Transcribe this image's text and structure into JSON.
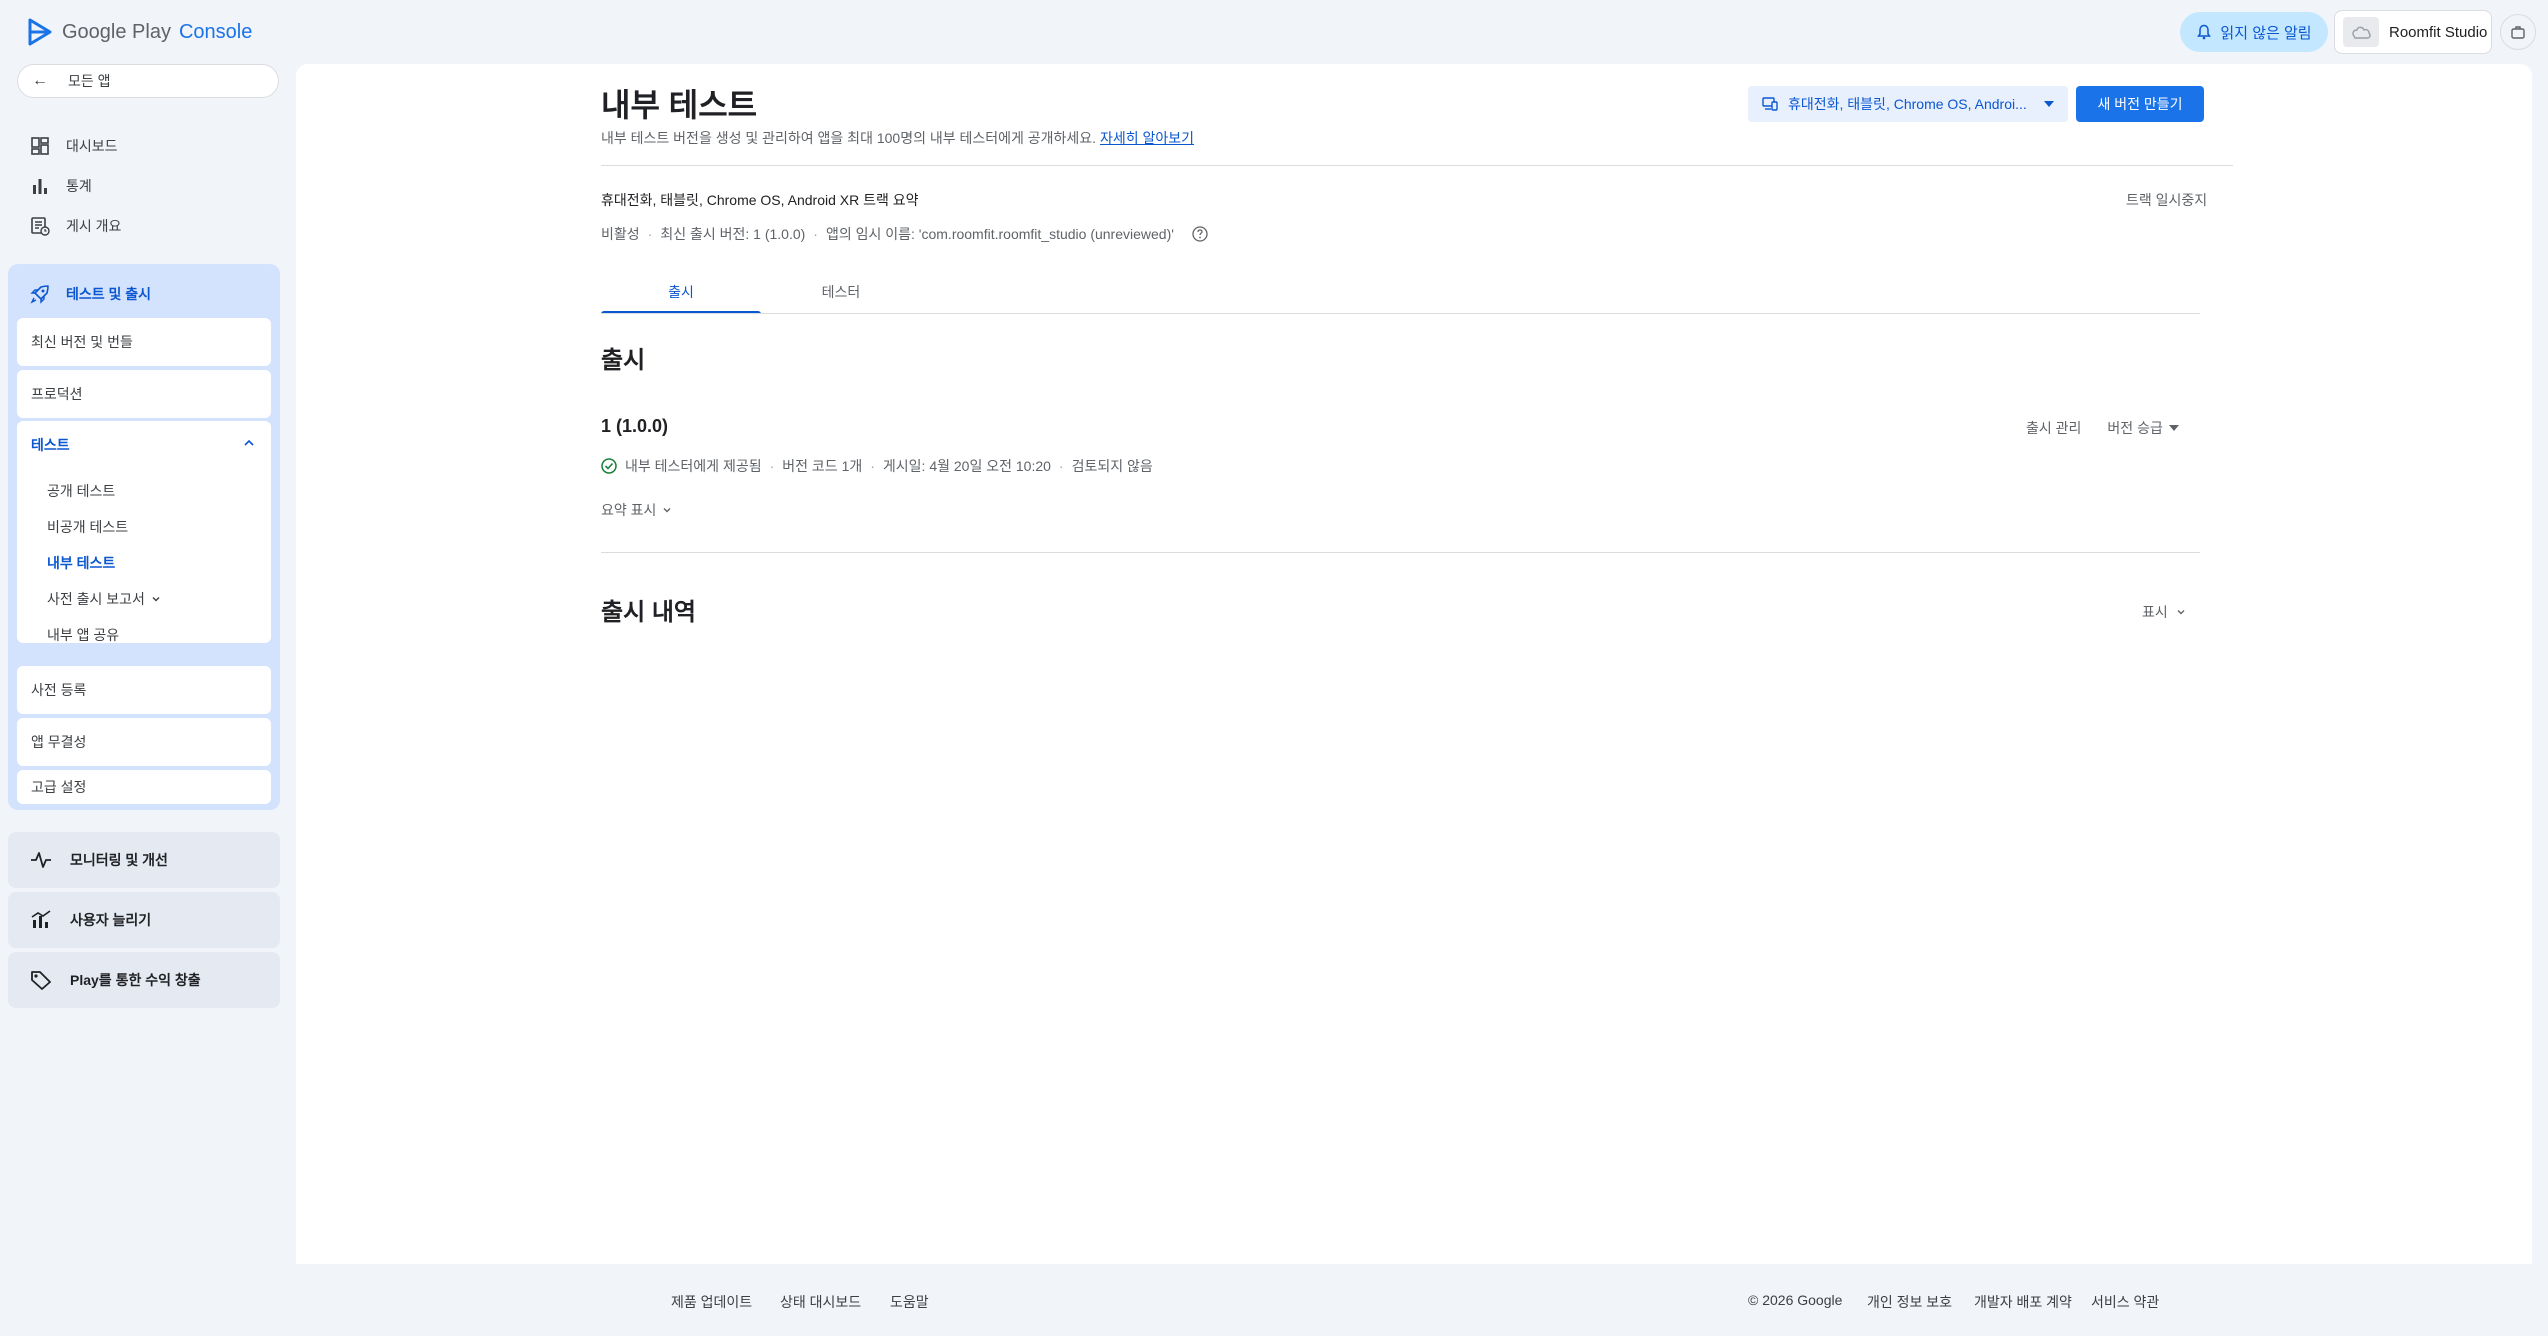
{
  "header": {
    "logo_google": "Google Play",
    "logo_console": "Console",
    "notifications_label": "읽지 않은 알림",
    "account_name": "Roomfit Studio"
  },
  "sidebar": {
    "all_apps": "모든 앱",
    "items": [
      {
        "label": "대시보드",
        "icon": "dashboard-icon"
      },
      {
        "label": "통계",
        "icon": "bar-chart-icon"
      },
      {
        "label": "게시 개요",
        "icon": "publishing-overview-icon"
      }
    ],
    "test_release": {
      "label": "테스트 및 출시",
      "icon": "rocket-icon",
      "latest_bundles": "최신 버전 및 번들",
      "production": "프로덕션",
      "testing": {
        "label": "테스트",
        "children": [
          "공개 테스트",
          "비공개 테스트",
          "내부 테스트",
          "사전 출시 보고서",
          "내부 앱 공유"
        ]
      },
      "pre_registration": "사전 등록",
      "app_integrity": "앱 무결성",
      "advanced_settings": "고급 설정"
    },
    "bottom": [
      {
        "label": "모니터링 및 개선",
        "icon": "monitoring-icon"
      },
      {
        "label": "사용자 늘리기",
        "icon": "grow-users-icon"
      },
      {
        "label": "Play를 통한 수익 창출",
        "icon": "tag-icon"
      }
    ]
  },
  "main": {
    "title": "내부 테스트",
    "description": "내부 테스트 버전을 생성 및 관리하여 앱을 최대 100명의 내부 테스터에게 공개하세요.",
    "learn_more": "자세히 알아보기",
    "device_select": "휴대전화, 태블릿, Chrome OS, Androi...",
    "new_release_button": "새 버전 만들기",
    "track_summary": "휴대전화, 태블릿, Chrome OS, Android XR 트랙 요약",
    "pause_track": "트랙 일시중지",
    "status": {
      "state": "비활성",
      "latest": "최신 출시 버전: 1 (1.0.0)",
      "temp_name": "앱의 임시 이름: 'com.roomfit.roomfit_studio (unreviewed)'"
    },
    "tabs": [
      "출시",
      "테스터"
    ],
    "release_section_title": "출시",
    "release": {
      "version": "1 (1.0.0)",
      "manage": "출시 관리",
      "promote": "버전 승급",
      "available": "내부 테스터에게 제공됨",
      "version_codes": "버전 코드 1개",
      "published": "게시일: 4월 20일 오전 10:20",
      "review": "검토되지 않음",
      "show_summary": "요약 표시"
    },
    "history_title": "출시 내역",
    "history_show": "표시"
  },
  "footer": {
    "left": [
      "제품 업데이트",
      "상태 대시보드",
      "도움말"
    ],
    "copyright": "© 2026 Google",
    "right": [
      "개인 정보 보호",
      "개발자 배포 계약",
      "서비스 약관"
    ]
  },
  "colors": {
    "accent": "#0b57d0",
    "primary_button": "#1a73e8",
    "selected_nav_bg": "#d3e3fd",
    "success": "#188038"
  }
}
